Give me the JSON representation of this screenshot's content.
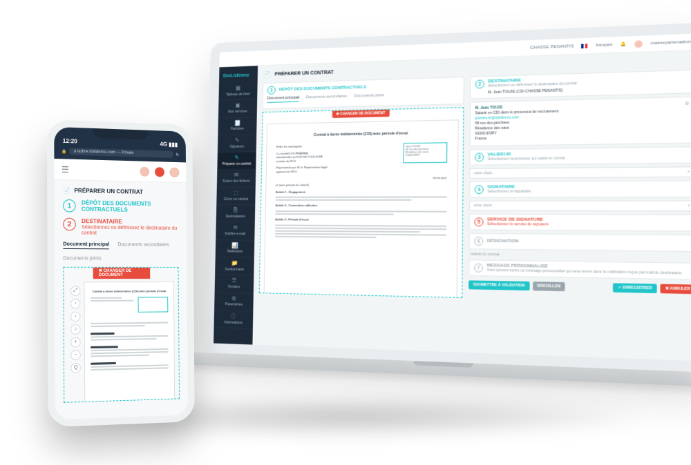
{
  "laptop": {
    "topbar": {
      "org": "CHASSE PENANTIS",
      "lang": "français",
      "user": "massepartenadmin"
    },
    "brand": "DoLidémo",
    "sidebar": [
      {
        "icon": "▦",
        "label": "Tableau de bord"
      },
      {
        "icon": "▣",
        "label": "Nos services"
      },
      {
        "icon": "🧾",
        "label": "Factures"
      },
      {
        "icon": "✎",
        "label": "Signature"
      },
      {
        "icon": "✎",
        "label": "Préparer un contrat"
      },
      {
        "icon": "✉",
        "label": "Suivre des fichiers"
      },
      {
        "icon": "⬚",
        "label": "Gérer un contrat"
      },
      {
        "icon": "⎘",
        "label": "Destinataires"
      },
      {
        "icon": "✉",
        "label": "Notifier e-mail"
      },
      {
        "icon": "📊",
        "label": "Statistique"
      },
      {
        "icon": "📁",
        "label": "Gestionnaire"
      },
      {
        "icon": "☰",
        "label": "Fichiers"
      },
      {
        "icon": "⚙",
        "label": "Paramètres"
      },
      {
        "icon": "ⓘ",
        "label": "Informations"
      }
    ],
    "page_title": "PRÉPARER UN CONTRAT",
    "step1": {
      "num": "1",
      "title": "DÉPÔT DES DOCUMENTS CONTRACTUELS"
    },
    "tabs": [
      "Document principal",
      "Documents secondaires",
      "Documents joints"
    ],
    "change_doc": "✖ CHANGER DE DOCUMENT",
    "doc": {
      "title": "Contrat à durée indéterminée (CDI) avec période d'essai",
      "entre": "Entre les soussignés :",
      "company": "La société DOLIPHARMA\nimmatriculée au RCS DE TOULOUSE\nnuméro du RCS",
      "sig_lines": [
        "Jean TOUZE",
        "58 rue des perchées",
        "Résidence des eaux",
        "91000 EVRY"
      ],
      "represent": "Représentée par M. le Représentant légal\nagissant en PDG",
      "dune": "d'une part,",
      "et": "et             (nom prénom du salarié)",
      "art1": "Article 1 - Engagement",
      "art2": "Article 2 - Convention collective",
      "art3": "Article 3 - Période d'essai"
    },
    "step2": {
      "num": "2",
      "title": "DESTINATAIRE",
      "sub": "Sélectionnez ou définissez le destinataire du contrat",
      "selected": "M. Jean TOUZE (CDI CHASSE PENANTIS)"
    },
    "dest": {
      "name": "M. Jean TOUZE",
      "detail": "Salarié en CDI dans le processus de recrutement",
      "mail": "jeantouze@dolidemo.com",
      "addr": [
        "58 rue des perchées",
        "Résidence des eaux",
        "91000 EVRY",
        "France"
      ]
    },
    "step3": {
      "num": "3",
      "title": "VALIDEUR",
      "sub": "Sélectionnez la personne qui valide le contrat"
    },
    "field3": "votre choix",
    "step4": {
      "num": "4",
      "title": "SIGNATAIRE",
      "sub": "Sélectionnez le signataire"
    },
    "field4": "votre choix",
    "step5": {
      "num": "5",
      "title": "SERVICE DE SIGNATURE",
      "sub": "Sélectionnez le service de signature"
    },
    "step6": {
      "num": "6",
      "title": "DÉSIGNATION"
    },
    "intitule": "Intitulé du contrat",
    "step7": {
      "num": "7",
      "title": "MESSAGE PERSONNALISÉ",
      "sub": "Vous pouvez écrire un message personnalisé qui sera inséré dans la notification reçue par mail du destinataire"
    },
    "actions": {
      "submit": "SOUMETTRE À VALIDATION",
      "draft": "BROUILLON",
      "save": "✓ ENREGISTRER",
      "cancel": "✖ ANNULER"
    }
  },
  "phone": {
    "time": "12:20",
    "signal": "4G",
    "url": "a larbre.dolidemo.com — Privée",
    "page_title": "PRÉPARER UN CONTRAT",
    "step1": {
      "num": "1",
      "title": "DÉPÔT DES DOCUMENTS CONTRACTUELS"
    },
    "step2": {
      "num": "2",
      "title": "DESTINATAIRE",
      "sub": "Sélectionnez ou définissez le destinataire du contrat"
    },
    "tabs": [
      "Document principal",
      "Documents secondaires"
    ],
    "joints": "Documents joints",
    "change": "✖ CHANGER DE DOCUMENT",
    "tools": [
      "⤢",
      "‹",
      "›",
      "⌂",
      "+",
      "−",
      "Q"
    ],
    "doc_title": "Contrat à durée indéterminée (CDI) avec période d'essai"
  }
}
